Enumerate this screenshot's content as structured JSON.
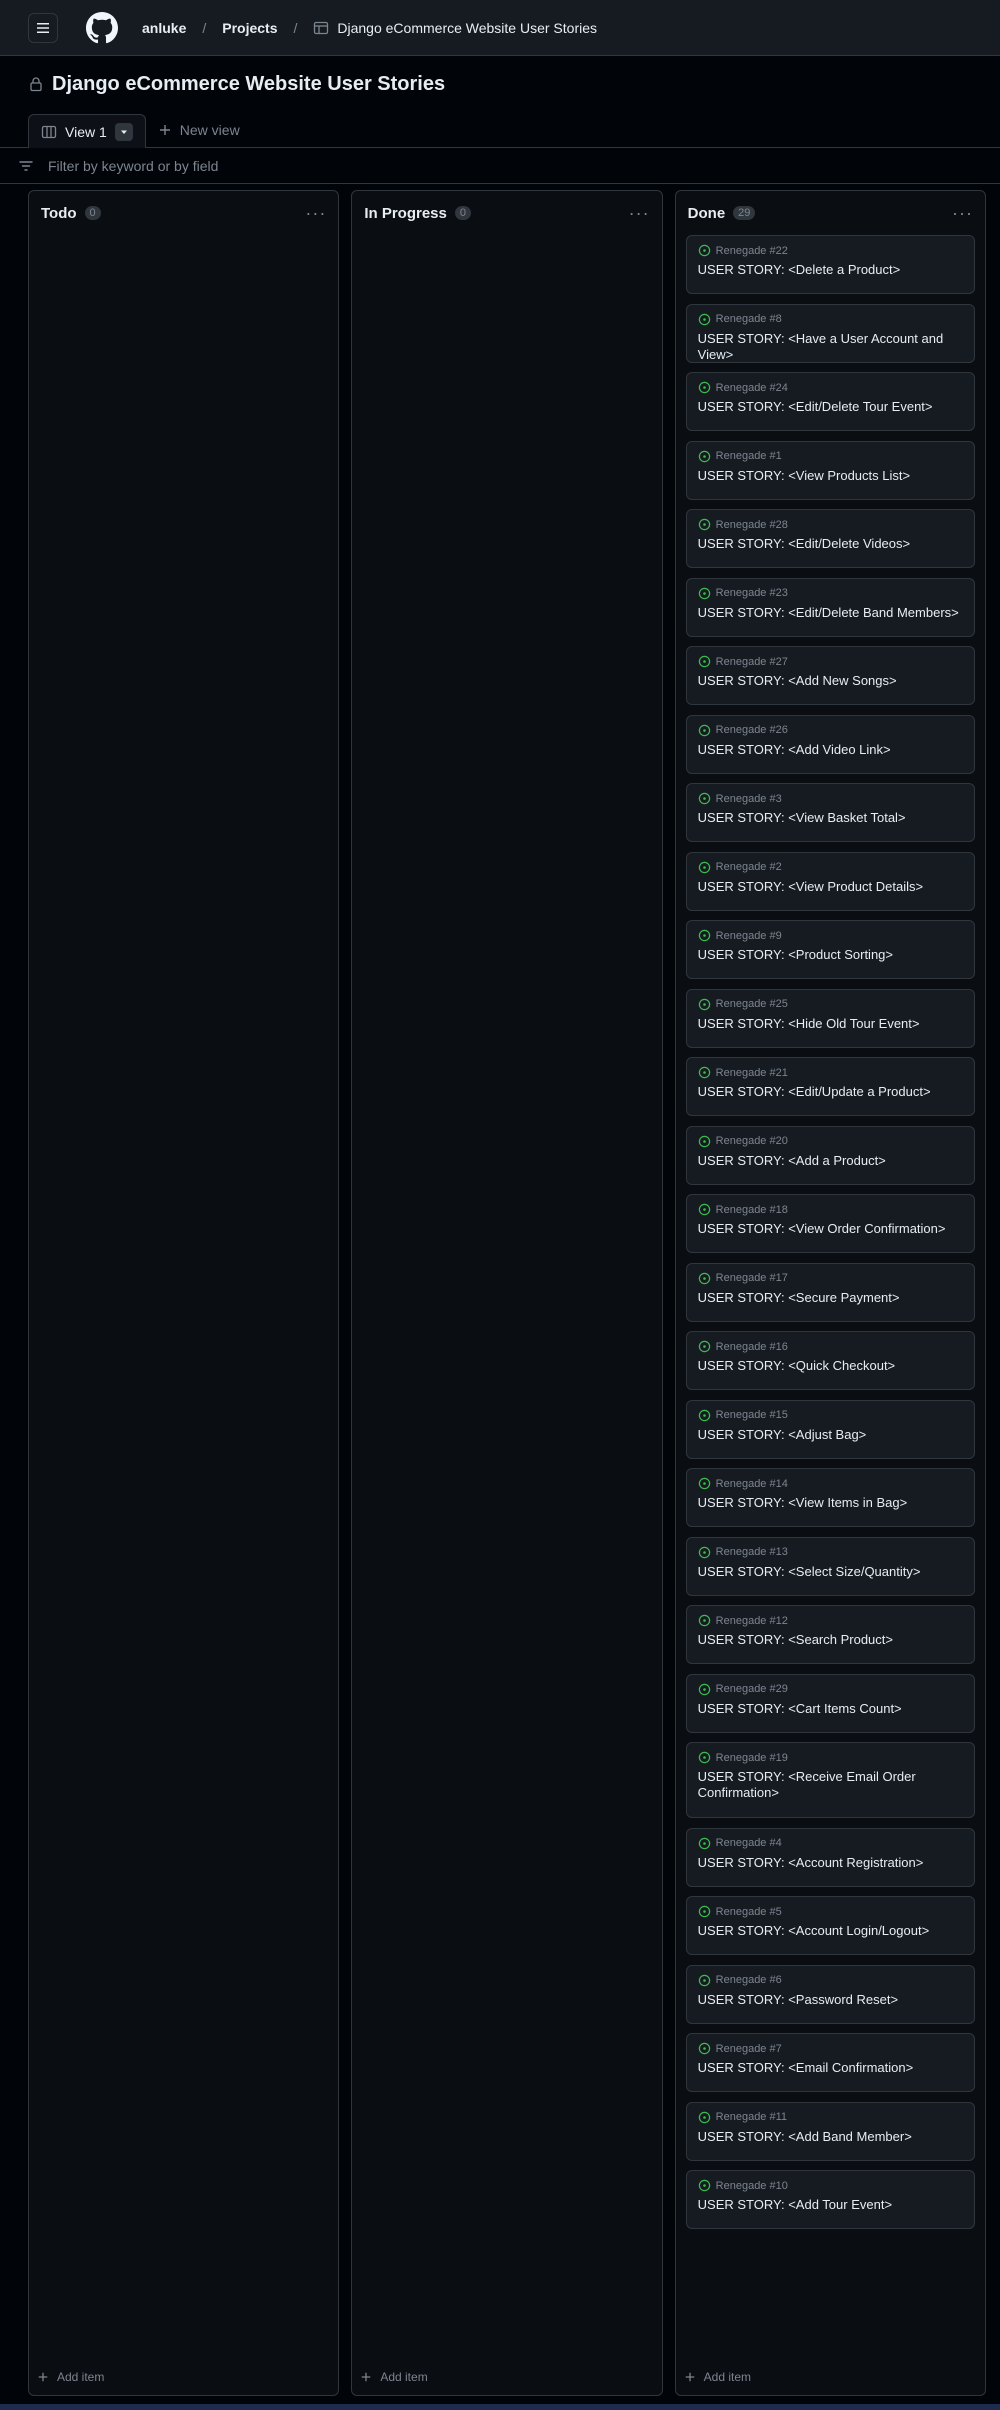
{
  "header": {
    "user": "anluke",
    "projects": "Projects",
    "project_name": "Django eCommerce Website User Stories"
  },
  "project": {
    "title": "Django eCommerce Website User Stories"
  },
  "views": {
    "active": "View 1",
    "new_view": "New view"
  },
  "filter": {
    "placeholder": "Filter by keyword or by field"
  },
  "board": {
    "add_item_label": "Add item",
    "columns": [
      {
        "title": "Todo",
        "count": "0"
      },
      {
        "title": "In Progress",
        "count": "0"
      },
      {
        "title": "Done",
        "count": "29"
      }
    ],
    "done_cards": [
      {
        "ref": "Renegade #22",
        "title": "USER STORY: <Delete a Product>"
      },
      {
        "ref": "Renegade #8",
        "title": "USER STORY: <Have a User Account and View>"
      },
      {
        "ref": "Renegade #24",
        "title": "USER STORY: <Edit/Delete Tour Event>"
      },
      {
        "ref": "Renegade #1",
        "title": "USER STORY: <View Products List>"
      },
      {
        "ref": "Renegade #28",
        "title": "USER STORY: <Edit/Delete Videos>"
      },
      {
        "ref": "Renegade #23",
        "title": "USER STORY: <Edit/Delete Band Members>"
      },
      {
        "ref": "Renegade #27",
        "title": "USER STORY: <Add New Songs>"
      },
      {
        "ref": "Renegade #26",
        "title": "USER STORY: <Add Video Link>"
      },
      {
        "ref": "Renegade #3",
        "title": "USER STORY: <View Basket Total>"
      },
      {
        "ref": "Renegade #2",
        "title": "USER STORY: <View Product Details>"
      },
      {
        "ref": "Renegade #9",
        "title": "USER STORY: <Product Sorting>"
      },
      {
        "ref": "Renegade #25",
        "title": "USER STORY: <Hide Old Tour Event>"
      },
      {
        "ref": "Renegade #21",
        "title": "USER STORY: <Edit/Update a Product>"
      },
      {
        "ref": "Renegade #20",
        "title": "USER STORY: <Add a Product>"
      },
      {
        "ref": "Renegade #18",
        "title": "USER STORY: <View Order Confirmation>"
      },
      {
        "ref": "Renegade #17",
        "title": "USER STORY: <Secure Payment>"
      },
      {
        "ref": "Renegade #16",
        "title": "USER STORY: <Quick Checkout>"
      },
      {
        "ref": "Renegade #15",
        "title": "USER STORY: <Adjust Bag>"
      },
      {
        "ref": "Renegade #14",
        "title": "USER STORY: <View Items in Bag>"
      },
      {
        "ref": "Renegade #13",
        "title": "USER STORY: <Select Size/Quantity>"
      },
      {
        "ref": "Renegade #12",
        "title": "USER STORY: <Search Product>"
      },
      {
        "ref": "Renegade #29",
        "title": "USER STORY: <Cart Items Count>"
      },
      {
        "ref": "Renegade #19",
        "title": "USER STORY: <Receive Email Order Confirmation>"
      },
      {
        "ref": "Renegade #4",
        "title": "USER STORY: <Account Registration>"
      },
      {
        "ref": "Renegade #5",
        "title": "USER STORY: <Account Login/Logout>"
      },
      {
        "ref": "Renegade #6",
        "title": "USER STORY: <Password Reset>"
      },
      {
        "ref": "Renegade #7",
        "title": "USER STORY: <Email Confirmation>"
      },
      {
        "ref": "Renegade #11",
        "title": "USER STORY: <Add Band Member>"
      },
      {
        "ref": "Renegade #10",
        "title": "USER STORY: <Add Tour Event>"
      }
    ]
  },
  "colors": {
    "background": "#010409",
    "surface": "#161b22",
    "border": "#30363d",
    "text": "#e6edf3",
    "muted": "#7d8590",
    "status_open": "#3fb950"
  },
  "icons": {
    "menu": "hamburger-icon",
    "logo": "github-logo-icon",
    "project": "table-icon",
    "lock": "lock-icon",
    "board_view": "board-icon",
    "caret": "caret-down-icon",
    "plus": "plus-icon",
    "filter": "filter-icon",
    "kebab": "kebab-horizontal-icon",
    "issue": "issue-opened-icon"
  }
}
